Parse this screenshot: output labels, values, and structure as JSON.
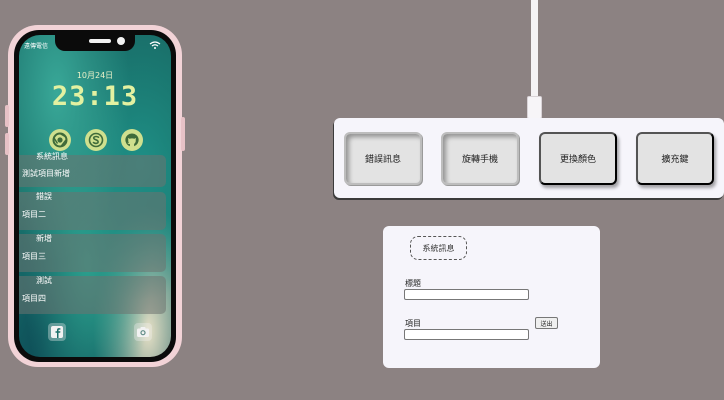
{
  "phone": {
    "carrier": "遠傳電信",
    "date": "10月24日",
    "time": "23:13",
    "app_icons": [
      "chrome-icon",
      "skype-icon",
      "github-icon"
    ],
    "cards": [
      {
        "title": "系統訊息",
        "item": "測試項目新增"
      },
      {
        "title": "錯誤",
        "item": "項目二"
      },
      {
        "title": "新增",
        "item": "項目三"
      },
      {
        "title": "測試",
        "item": "項目四"
      }
    ],
    "dock_icons": [
      "facebook-icon",
      "camera-icon"
    ]
  },
  "keyboard": {
    "keys": [
      {
        "label": "錯誤訊息",
        "pressed": true
      },
      {
        "label": "旋轉手機",
        "pressed": true
      },
      {
        "label": "更換顏色",
        "pressed": false
      },
      {
        "label": "擴充鍵",
        "pressed": false
      }
    ]
  },
  "form": {
    "system_button_label": "系統訊息",
    "title_label": "標題",
    "title_value": "",
    "item_label": "項目",
    "item_value": "",
    "send_label": "送出"
  },
  "colors": {
    "background": "#8c8282",
    "phone_frame": "#f2d3d7",
    "time_color": "#e3f1a1",
    "icon_bg": "#cfe08e",
    "panel_bg": "#f6f5fb",
    "key_bg": "#e3e3e3"
  }
}
